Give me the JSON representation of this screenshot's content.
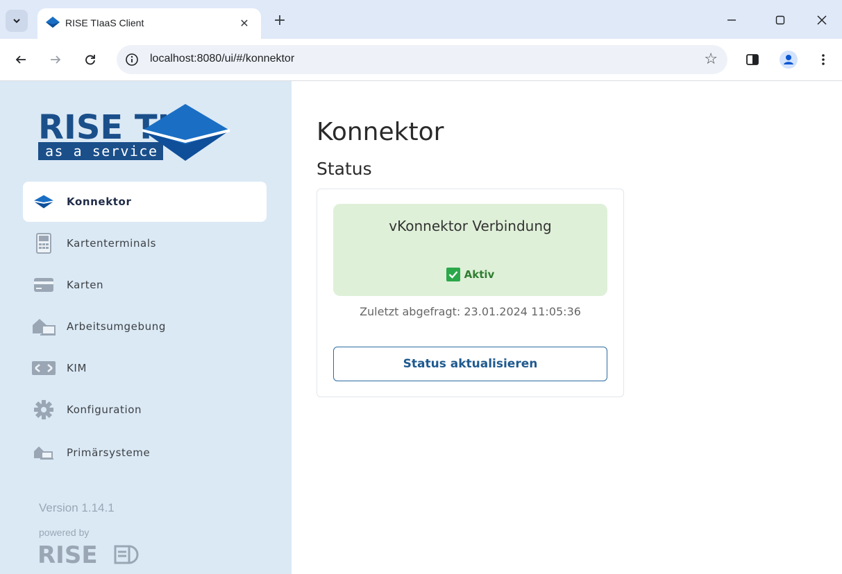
{
  "browser": {
    "tab_title": "RISE TIaaS Client",
    "url": "localhost:8080/ui/#/konnektor",
    "new_tab": "+",
    "close": "✕"
  },
  "logo": {
    "brand": "RISE TI",
    "tagline": "as a service",
    "brand_color": "#1a4f8a",
    "accent_color": "#1a6fc4"
  },
  "sidebar": {
    "items": [
      {
        "label": "Konnektor",
        "icon": "konnektor-icon",
        "active": true
      },
      {
        "label": "Kartenterminals",
        "icon": "card-terminal-icon"
      },
      {
        "label": "Karten",
        "icon": "card-icon"
      },
      {
        "label": "Arbeitsumgebung",
        "icon": "workplace-icon"
      },
      {
        "label": "KIM",
        "icon": "kim-icon"
      },
      {
        "label": "Konfiguration",
        "icon": "gear-icon"
      },
      {
        "label": "Primärsysteme",
        "icon": "primary-systems-icon"
      }
    ],
    "version": "Version 1.14.1",
    "powered_by": "powered by",
    "footer_brand": "RISE"
  },
  "main": {
    "title": "Konnektor",
    "section": "Status",
    "card": {
      "status_title": "vKonnektor Verbindung",
      "status_label": "Aktiv",
      "status_color": "#2ba84a",
      "last_query": "Zuletzt abgefragt: 23.01.2024 11:05:36",
      "refresh_button": "Status aktualisieren"
    }
  }
}
